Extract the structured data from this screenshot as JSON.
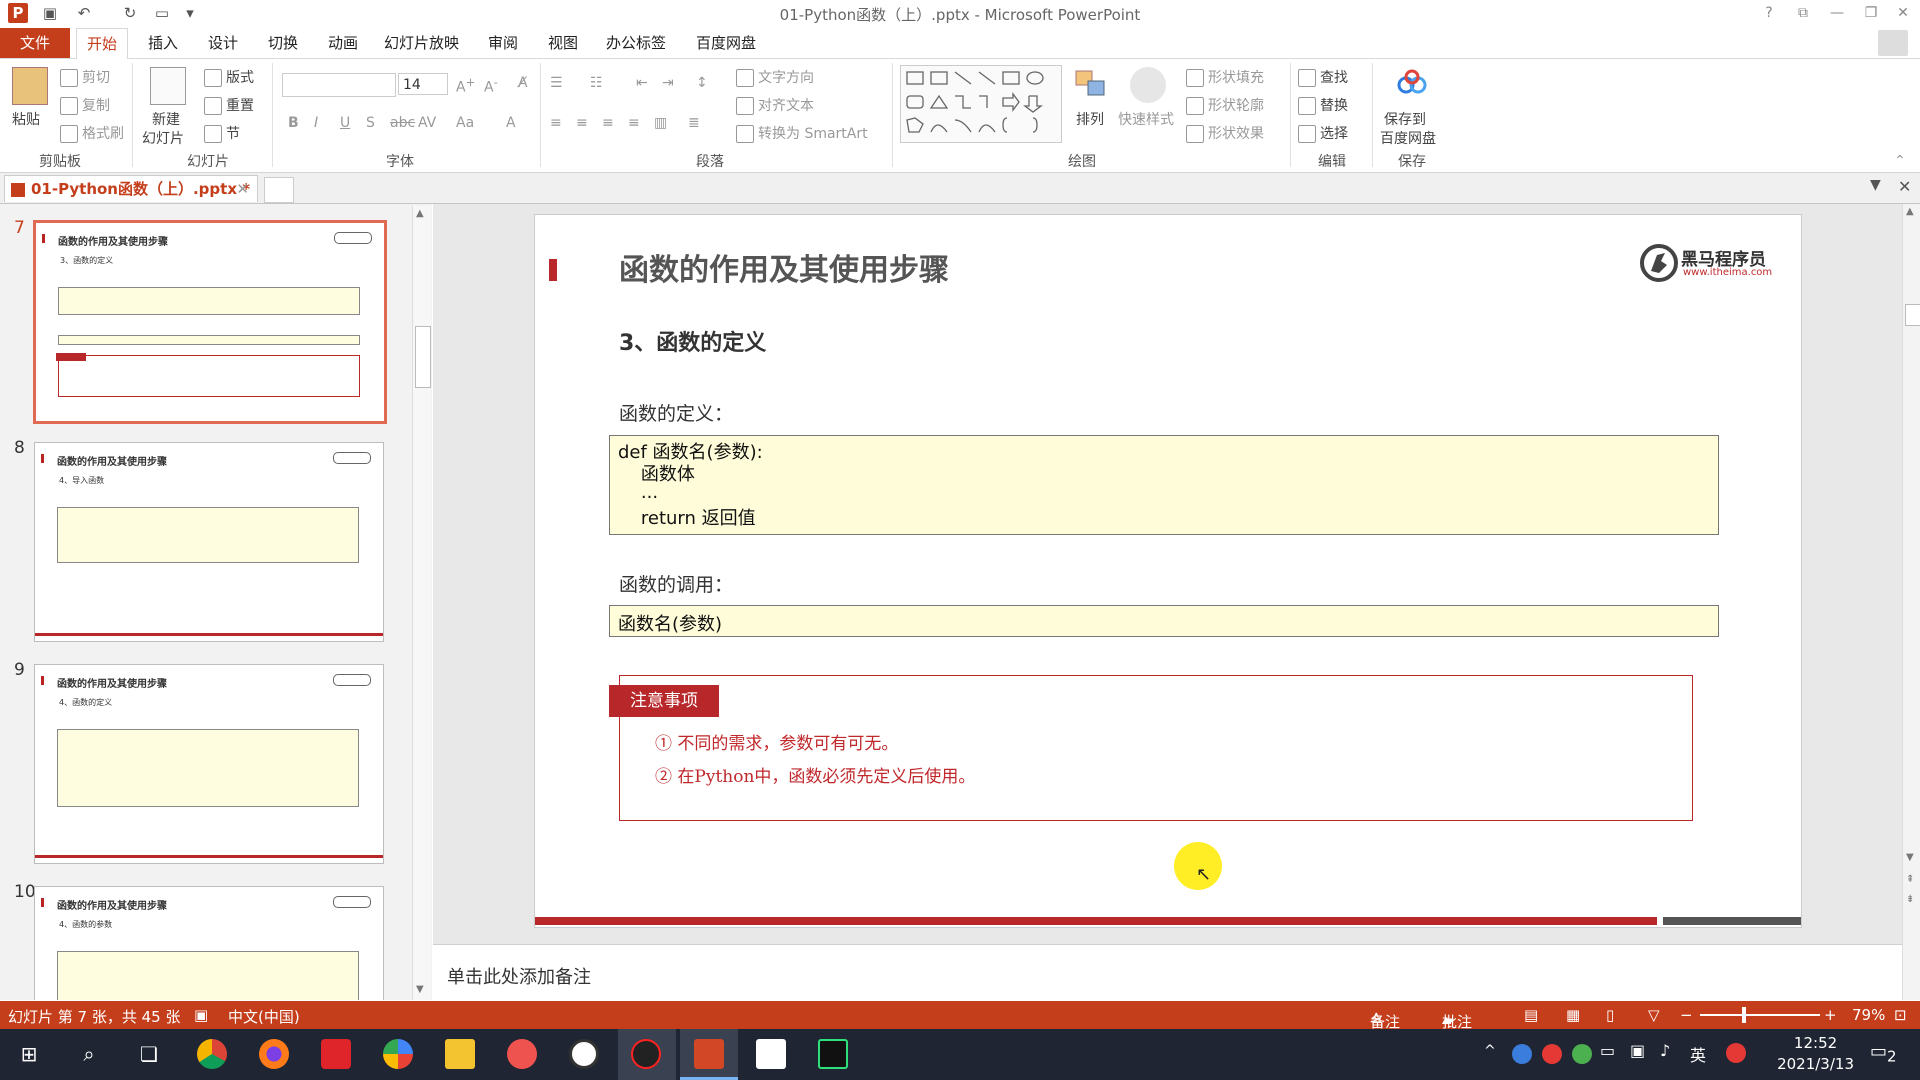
{
  "window": {
    "title": "01-Python函数（上）.pptx - Microsoft PowerPoint"
  },
  "colors": {
    "accent": "#c43e1c",
    "slide_red": "#b8272a",
    "code_bg": "#fffdd9",
    "taskbar": "#1f2532"
  },
  "menu": [
    "文件",
    "开始",
    "插入",
    "设计",
    "切换",
    "动画",
    "幻灯片放映",
    "审阅",
    "视图",
    "办公标签",
    "百度网盘"
  ],
  "ribbon": {
    "clipboard": {
      "paste": "粘贴",
      "cut": "剪切",
      "copy": "复制",
      "format_painter": "格式刷",
      "label": "剪贴板"
    },
    "slides": {
      "new_slide_1": "新建",
      "new_slide_2": "幻灯片",
      "layout": "版式",
      "reset": "重置",
      "section": "节",
      "label": "幻灯片"
    },
    "font": {
      "size": "14",
      "label": "字体"
    },
    "paragraph": {
      "text_direction": "文字方向",
      "align_text": "对齐文本",
      "smartart": "转换为 SmartArt",
      "label": "段落"
    },
    "drawing": {
      "arrange": "排列",
      "quick_styles": "快速样式",
      "shape_fill": "形状填充",
      "shape_outline": "形状轮廓",
      "shape_effects": "形状效果",
      "label": "绘图"
    },
    "editing": {
      "find": "查找",
      "replace": "替换",
      "select": "选择",
      "label": "编辑"
    },
    "save": {
      "save_to_1": "保存到",
      "save_to_2": "百度网盘",
      "label": "保存"
    }
  },
  "doc_tab": "01-Python函数（上）.pptx *",
  "thumbnails": [
    {
      "num": "7",
      "title": "函数的作用及其使用步骤",
      "sub": "3、函数的定义"
    },
    {
      "num": "8",
      "title": "函数的作用及其使用步骤",
      "sub": "4、导入函数"
    },
    {
      "num": "9",
      "title": "函数的作用及其使用步骤",
      "sub": "4、函数的定义"
    },
    {
      "num": "10",
      "title": "函数的作用及其使用步骤",
      "sub": "4、函数的参数"
    }
  ],
  "slide": {
    "title": "函数的作用及其使用步骤",
    "subtitle": "3、函数的定义",
    "logo_name": "黑马程序员",
    "logo_url": "www.itheima.com",
    "def_label": "函数的定义：",
    "def_code": [
      "def 函数名(参数):",
      "    函数体",
      "    ...",
      "    return 返回值"
    ],
    "call_label": "函数的调用：",
    "call_code": "函数名(参数)",
    "note_title": "注意事项",
    "notes": [
      "① 不同的需求，参数可有可无。",
      "② 在Python中，函数必须先定义后使用。"
    ]
  },
  "notes_placeholder": "单击此处添加备注",
  "status": {
    "slide_info": "幻灯片 第 7 张，共 45 张",
    "language": "中文(中国)",
    "notes_btn": "备注",
    "comments_btn": "批注",
    "zoom": "79%"
  },
  "taskbar": {
    "ime": "英",
    "time": "12:52",
    "date": "2021/3/13",
    "notif_count": "2"
  }
}
